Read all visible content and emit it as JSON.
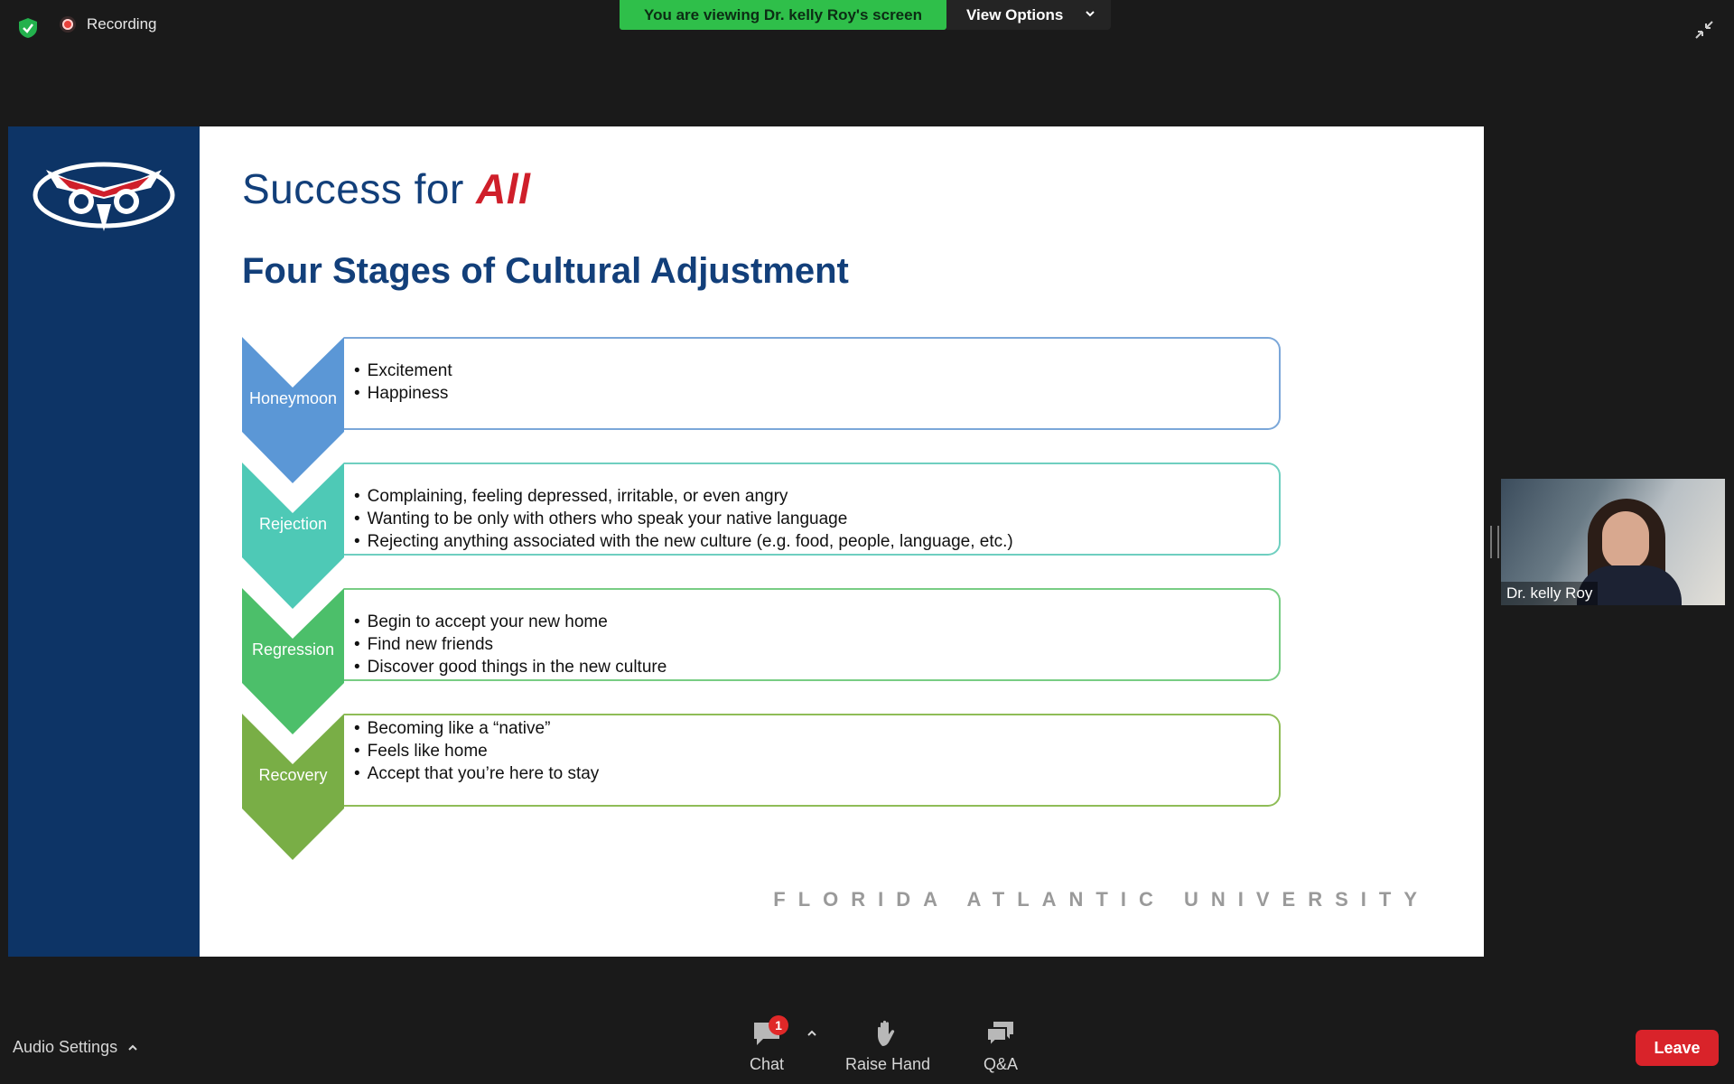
{
  "top_bar": {
    "recording_label": "Recording",
    "viewing_banner": "You are viewing Dr. kelly Roy's screen",
    "view_options_label": "View Options"
  },
  "slide": {
    "heading_prefix": "Success for ",
    "heading_emphasis": "All",
    "title": "Four Stages of Cultural Adjustment",
    "stages": [
      {
        "name": "Honeymoon",
        "color": "#5b97d6",
        "border": "#7ba7d9",
        "bullets": [
          "Excitement",
          "Happiness"
        ]
      },
      {
        "name": "Rejection",
        "color": "#4ec9b6",
        "border": "#6fcfc0",
        "bullets": [
          "Complaining, feeling depressed, irritable, or even angry",
          "Wanting to be only with others who speak your native language",
          "Rejecting anything associated with the new culture (e.g. food, people, language, etc.)"
        ]
      },
      {
        "name": "Regression",
        "color": "#4cbf6a",
        "border": "#78cd84",
        "bullets": [
          "Begin to accept your new home",
          "Find new friends",
          "Discover good things in the new culture"
        ]
      },
      {
        "name": "Recovery",
        "color": "#79ae46",
        "border": "#8fbd57",
        "bullets": [
          "Becoming like a “native”",
          "Feels like home",
          "Accept that you’re here to stay"
        ]
      }
    ],
    "footer": "FLORIDA ATLANTIC UNIVERSITY"
  },
  "participant": {
    "name": "Dr. kelly Roy"
  },
  "bottom_bar": {
    "audio_settings_label": "Audio Settings",
    "chat_label": "Chat",
    "chat_badge": "1",
    "raise_hand_label": "Raise Hand",
    "qa_label": "Q&A",
    "leave_label": "Leave"
  },
  "colors": {
    "banner_green": "#2fbf4a",
    "leave_red": "#d9232a",
    "slide_navy": "#0d3466",
    "brand_red": "#cf1f2a"
  }
}
